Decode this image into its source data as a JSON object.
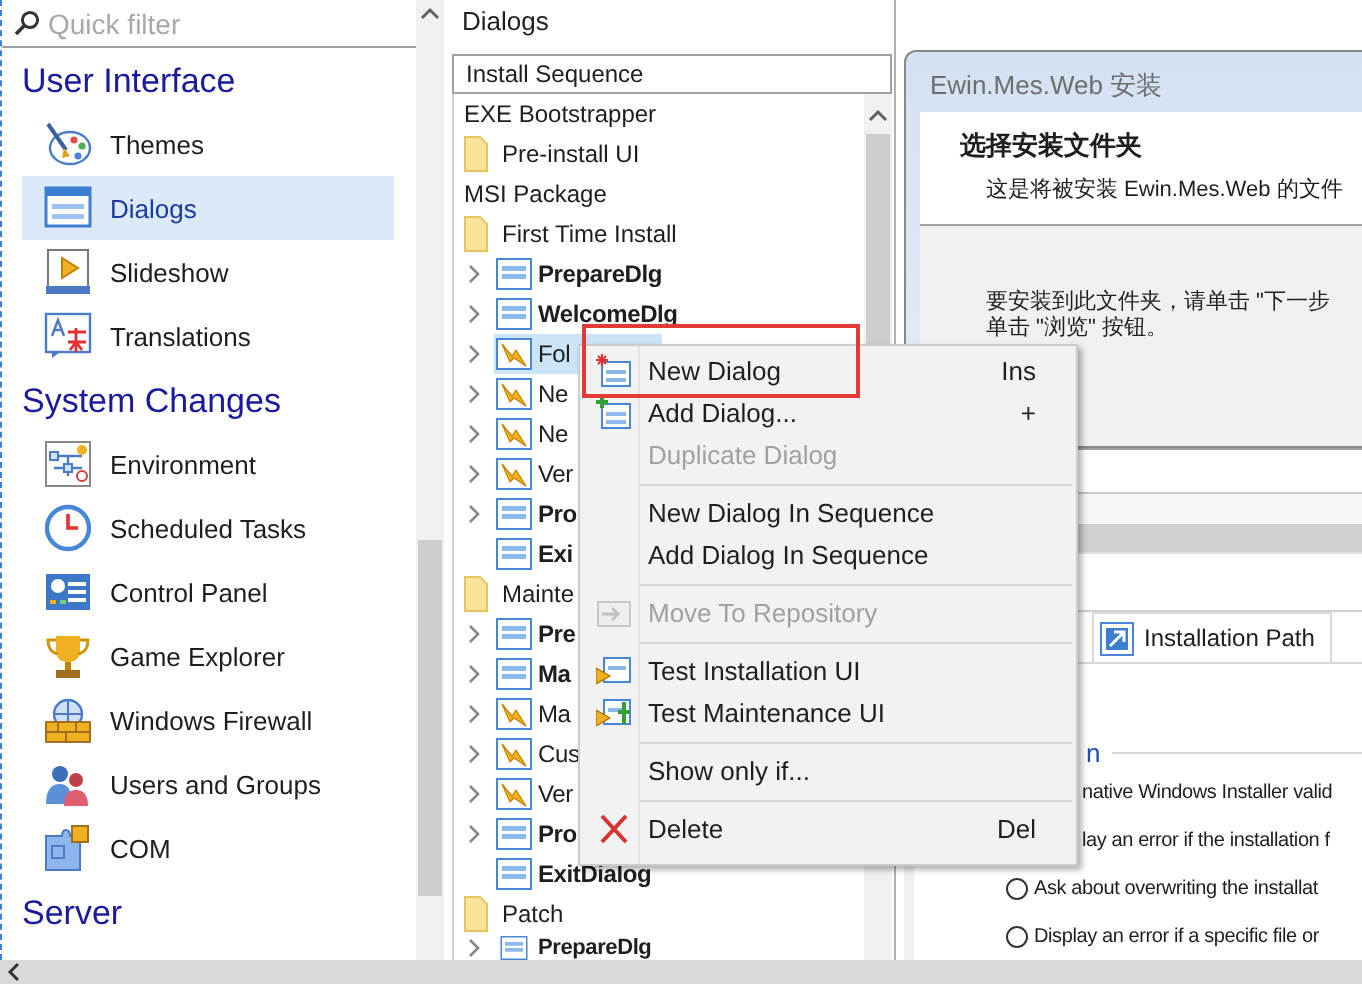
{
  "sidebar": {
    "search": {
      "placeholder": "Quick filter"
    },
    "sections": [
      {
        "title": "User Interface",
        "items": [
          {
            "label": "Themes",
            "selected": false
          },
          {
            "label": "Dialogs",
            "selected": true
          },
          {
            "label": "Slideshow",
            "selected": false
          },
          {
            "label": "Translations",
            "selected": false
          }
        ]
      },
      {
        "title": "System Changes",
        "items": [
          {
            "label": "Environment",
            "selected": false
          },
          {
            "label": "Scheduled Tasks",
            "selected": false
          },
          {
            "label": "Control Panel",
            "selected": false
          },
          {
            "label": "Game Explorer",
            "selected": false
          },
          {
            "label": "Windows Firewall",
            "selected": false
          },
          {
            "label": "Users and Groups",
            "selected": false
          },
          {
            "label": "COM",
            "selected": false
          }
        ]
      },
      {
        "title": "Server"
      }
    ]
  },
  "dialogs_panel": {
    "title": "Dialogs",
    "sequence": "Install Sequence",
    "tree": [
      {
        "kind": "group",
        "label": "EXE Bootstrapper",
        "children": [
          {
            "kind": "folder",
            "label": "Pre-install UI"
          }
        ]
      },
      {
        "kind": "group",
        "label": "MSI Package",
        "children": [
          {
            "kind": "folder",
            "label": "First Time Install",
            "children": [
              {
                "kind": "dialog",
                "label": "PrepareDlg",
                "bold": true,
                "expandable": true,
                "selected": false
              },
              {
                "kind": "dialog",
                "label": "WelcomeDlg",
                "bold": true,
                "expandable": true,
                "selected": false
              },
              {
                "kind": "custom",
                "label": "Fol",
                "bold": false,
                "expandable": true,
                "selected": true
              },
              {
                "kind": "custom",
                "label": "Ne",
                "bold": false,
                "expandable": true,
                "selected": false
              },
              {
                "kind": "custom",
                "label": "Ne",
                "bold": false,
                "expandable": true,
                "selected": false
              },
              {
                "kind": "custom",
                "label": "Ver",
                "bold": false,
                "expandable": true,
                "selected": false
              },
              {
                "kind": "dialog",
                "label": "Pro",
                "bold": true,
                "expandable": true,
                "selected": false
              },
              {
                "kind": "dialog",
                "label": "Exi",
                "bold": true,
                "expandable": false,
                "selected": false
              }
            ]
          },
          {
            "kind": "folder",
            "label": "Mainte",
            "children": [
              {
                "kind": "dialog",
                "label": "Pre",
                "bold": true,
                "expandable": true,
                "selected": false
              },
              {
                "kind": "dialog",
                "label": "Ma",
                "bold": true,
                "expandable": true,
                "selected": false
              },
              {
                "kind": "custom",
                "label": "Ma",
                "bold": false,
                "expandable": true,
                "selected": false
              },
              {
                "kind": "custom",
                "label": "Cus",
                "bold": false,
                "expandable": true,
                "selected": false
              },
              {
                "kind": "custom",
                "label": "Ver",
                "bold": false,
                "expandable": true,
                "selected": false
              },
              {
                "kind": "dialog",
                "label": "Pro",
                "bold": true,
                "expandable": true,
                "selected": false
              },
              {
                "kind": "dialog",
                "label": "ExitDialog",
                "bold": true,
                "expandable": false,
                "selected": false
              }
            ]
          },
          {
            "kind": "folder",
            "label": "Patch",
            "children": [
              {
                "kind": "dialog",
                "label": "PrepareDlg",
                "bold": true,
                "expandable": true,
                "selected": false
              }
            ]
          }
        ]
      }
    ]
  },
  "preview": {
    "window_title": "Ewin.Mes.Web 安装",
    "heading": "选择安装文件夹",
    "subtitle": "这是将被安装 Ewin.Mes.Web 的文件",
    "instructions": [
      "要安装到此文件夹，请单击 \"下一步",
      "单击 \"浏览\" 按钮。"
    ],
    "tabs": [
      {
        "label": "Installation Path",
        "selected": true
      }
    ],
    "group_label": "n",
    "options": [
      {
        "kind": "text",
        "label": "native Windows Installer valid"
      },
      {
        "kind": "text",
        "label": "lay an error if the installation f"
      },
      {
        "kind": "radio",
        "label": "Ask about overwriting the installat",
        "checked": false
      },
      {
        "kind": "radio",
        "label": "Display an error if a specific file or",
        "checked": false
      }
    ]
  },
  "context_menu": {
    "items": [
      {
        "kind": "new",
        "label": "New Dialog",
        "shortcut": "Ins",
        "disabled": false,
        "highlighted": true
      },
      {
        "kind": "add",
        "label": "Add Dialog...",
        "shortcut": "+",
        "disabled": false,
        "highlighted": false
      },
      {
        "kind": "plain",
        "label": "Duplicate Dialog",
        "disabled": true,
        "highlighted": false
      },
      {
        "kind": "separator"
      },
      {
        "kind": "plain",
        "label": "New Dialog In Sequence",
        "disabled": false,
        "highlighted": false
      },
      {
        "kind": "plain",
        "label": "Add Dialog In Sequence",
        "disabled": false,
        "highlighted": false
      },
      {
        "kind": "separator"
      },
      {
        "kind": "move",
        "label": "Move To Repository",
        "disabled": true,
        "highlighted": false
      },
      {
        "kind": "separator"
      },
      {
        "kind": "test",
        "label": "Test Installation UI",
        "disabled": false,
        "highlighted": false
      },
      {
        "kind": "test-maintenance",
        "label": "Test Maintenance UI",
        "disabled": false,
        "highlighted": false
      },
      {
        "kind": "separator"
      },
      {
        "kind": "plain",
        "label": "Show only if...",
        "disabled": false,
        "highlighted": false
      },
      {
        "kind": "separator"
      },
      {
        "kind": "delete",
        "label": "Delete",
        "shortcut": "Del",
        "disabled": false,
        "highlighted": false
      }
    ]
  }
}
